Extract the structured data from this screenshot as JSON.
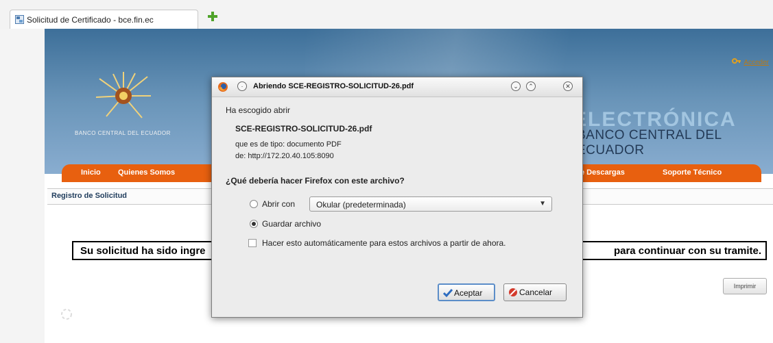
{
  "browser": {
    "tab_title": "Solicitud de Certificado - bce.fin.ec"
  },
  "page": {
    "acceder_link": "Acceder",
    "bank_name_small": "BANCO CENTRAL DEL ECUADOR",
    "banner_word": "ELECTRÓNICA",
    "bank_name_large": "BANCO CENTRAL DEL ECUADOR",
    "nav": [
      {
        "label": "Inicio"
      },
      {
        "label": "Quienes Somos"
      },
      {
        "label": "e Descargas"
      },
      {
        "label": "Soporte Técnico"
      }
    ],
    "section_title": "Registro de Solicitud",
    "message_left": "Su solicitud ha sido ingre",
    "message_right": "para continuar con su tramite.",
    "print_button": "Imprimir"
  },
  "dialog": {
    "title": "Abriendo SCE-REGISTRO-SOLICITUD-26.pdf",
    "intro": "Ha escogido abrir",
    "filename": "SCE-REGISTRO-SOLICITUD-26.pdf",
    "type_line": "que es de tipo:  documento PDF",
    "from_line": "de:  http://172.20.40.105:8090",
    "question": "¿Qué debería hacer Firefox con este archivo?",
    "open_with_label": "Abrir con",
    "open_with_app": "Okular (predeterminada)",
    "save_label": "Guardar archivo",
    "auto_label": "Hacer esto automáticamente para estos archivos a partir de ahora.",
    "accept_button": "Aceptar",
    "cancel_button": "Cancelar",
    "selected_option": "save"
  },
  "colors": {
    "nav_orange": "#e8600f",
    "banner_blue": "#3d6f99",
    "dialog_bg": "#ececec"
  }
}
